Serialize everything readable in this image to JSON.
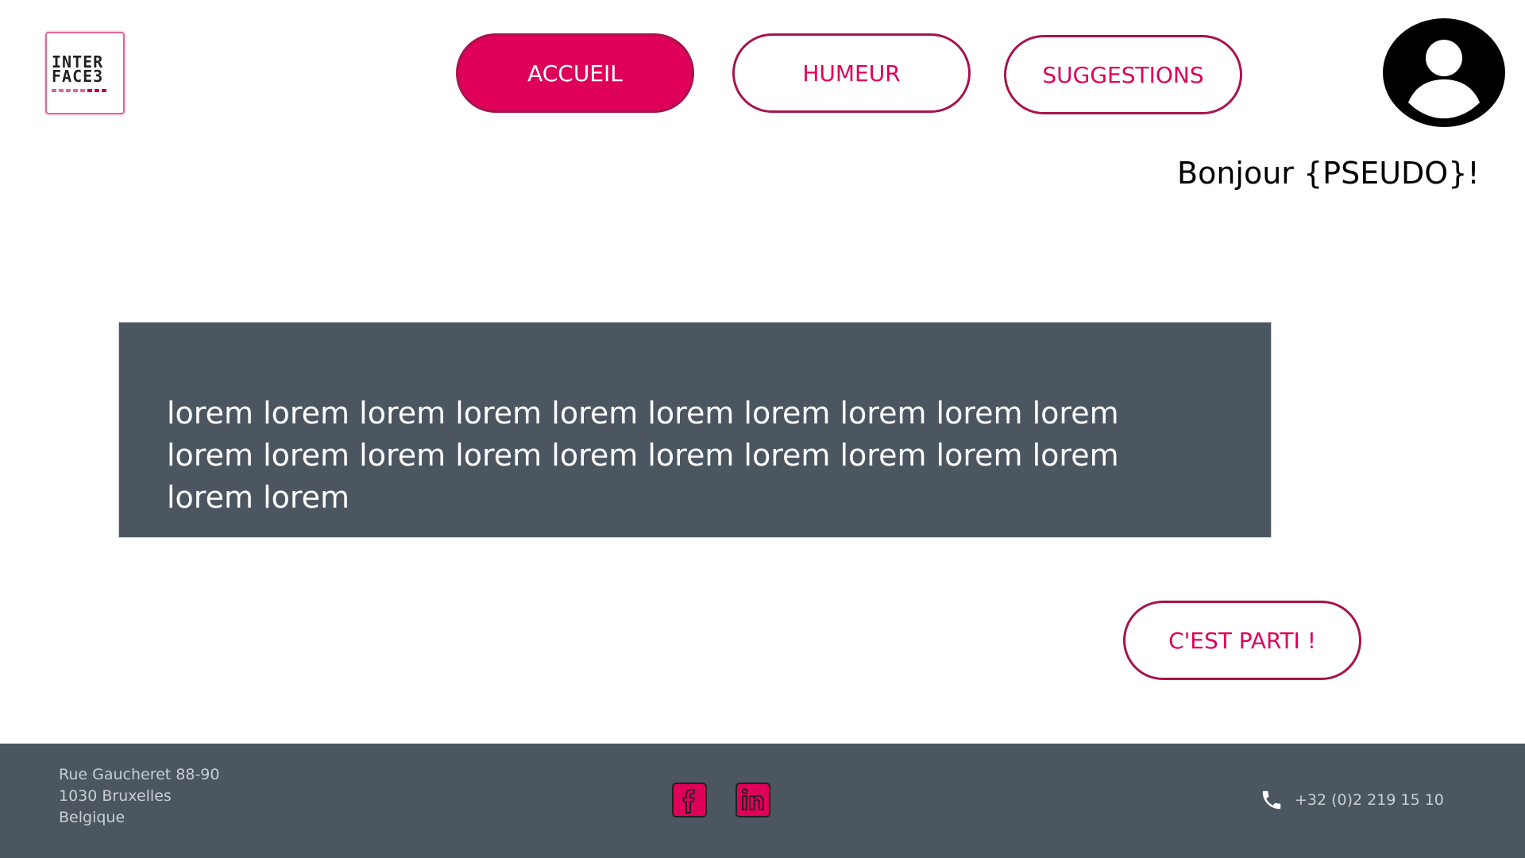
{
  "header": {
    "logo": {
      "line1": "INTER",
      "line2": "FACE3",
      "icon": "interface3-logo"
    },
    "nav": [
      {
        "label": "ACCUEIL",
        "active": true
      },
      {
        "label": "HUMEUR",
        "active": false
      },
      {
        "label": "SUGGESTIONS",
        "active": false
      }
    ],
    "avatar_icon": "user-avatar-icon",
    "greeting": "Bonjour {PSEUDO}!"
  },
  "main": {
    "panel_text": "lorem lorem lorem lorem lorem lorem lorem lorem lorem lorem lorem lorem lorem lorem lorem lorem lorem lorem lorem lorem lorem lorem",
    "cta_label": "C'EST PARTI !"
  },
  "footer": {
    "address": [
      "Rue Gaucheret 88-90",
      "1030 Bruxelles",
      "Belgique"
    ],
    "social": [
      {
        "icon": "facebook-icon"
      },
      {
        "icon": "linkedin-icon"
      }
    ],
    "phone_icon": "phone-icon",
    "phone": "+32 (0)2 219 15 10"
  },
  "colors": {
    "accent": "#df005a",
    "accent_border": "#a8134c",
    "panel_bg": "#4b5660",
    "footer_bg": "#4b5660",
    "footer_text": "#c9ced3"
  }
}
